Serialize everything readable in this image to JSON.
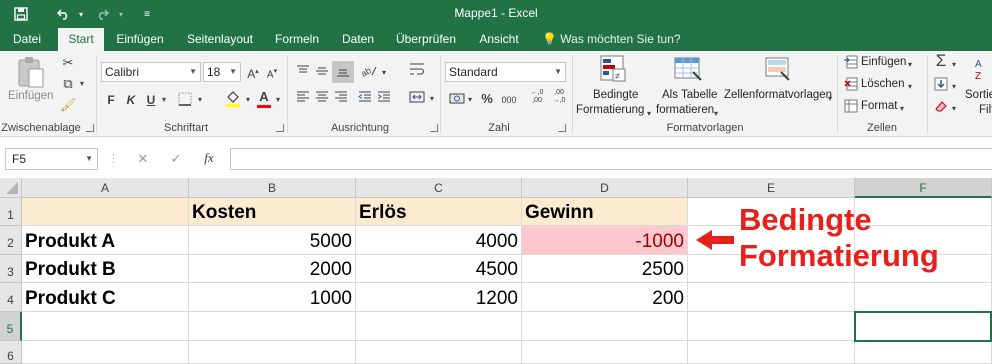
{
  "window": {
    "title": "Mappe1 - Excel"
  },
  "qat": {
    "save_icon": "save-icon",
    "undo_icon": "undo-icon",
    "redo_icon": "redo-icon",
    "customize_icon": "customize-qat-icon"
  },
  "tabs": [
    "Datei",
    "Start",
    "Einfügen",
    "Seitenlayout",
    "Formeln",
    "Daten",
    "Überprüfen",
    "Ansicht"
  ],
  "tellme": "Was möchten Sie tun?",
  "ribbon": {
    "clipboard": {
      "paste_label": "Einfügen",
      "group_label": "Zwischenablage"
    },
    "font": {
      "family": "Calibri",
      "size": "18",
      "bold": "F",
      "italic": "K",
      "underline": "U",
      "group_label": "Schriftart"
    },
    "alignment": {
      "group_label": "Ausrichtung"
    },
    "number": {
      "format": "Standard",
      "percent": "%",
      "thousands": "000",
      "group_label": "Zahl"
    },
    "styles": {
      "cond_line1": "Bedingte",
      "cond_line2": "Formatierung",
      "table_line1": "Als Tabelle",
      "table_line2": "formatieren",
      "cellstyles": "Zellenformatvorlagen",
      "group_label": "Formatvorlagen"
    },
    "cells": {
      "insert": "Einfügen",
      "delete": "Löschen",
      "format": "Format",
      "group_label": "Zellen"
    },
    "editing": {
      "sort_line1": "Sortie",
      "sort_line2": "Filt"
    }
  },
  "formula_bar": {
    "name_box": "F5",
    "cancel": "✕",
    "enter": "✓",
    "fx": "fx",
    "content": ""
  },
  "columns": [
    "A",
    "B",
    "C",
    "D",
    "E",
    "F"
  ],
  "rows": [
    "1",
    "2",
    "3",
    "4",
    "5",
    "6"
  ],
  "sheet": {
    "header": [
      "",
      "Kosten",
      "Erlös",
      "Gewinn"
    ],
    "data": [
      {
        "label": "Produkt A",
        "kosten": "5000",
        "erloes": "4000",
        "gewinn": "-1000"
      },
      {
        "label": "Produkt B",
        "kosten": "2000",
        "erloes": "4500",
        "gewinn": "2500"
      },
      {
        "label": "Produkt C",
        "kosten": "1000",
        "erloes": "1200",
        "gewinn": "200"
      }
    ]
  },
  "annotation": {
    "line1": "Bedingte",
    "line2": "Formatierung"
  },
  "colors": {
    "excel_green": "#217346",
    "header_fill": "#fdebcf",
    "negative_fill": "#ffc7ce",
    "annotation_red": "#e8201c"
  }
}
